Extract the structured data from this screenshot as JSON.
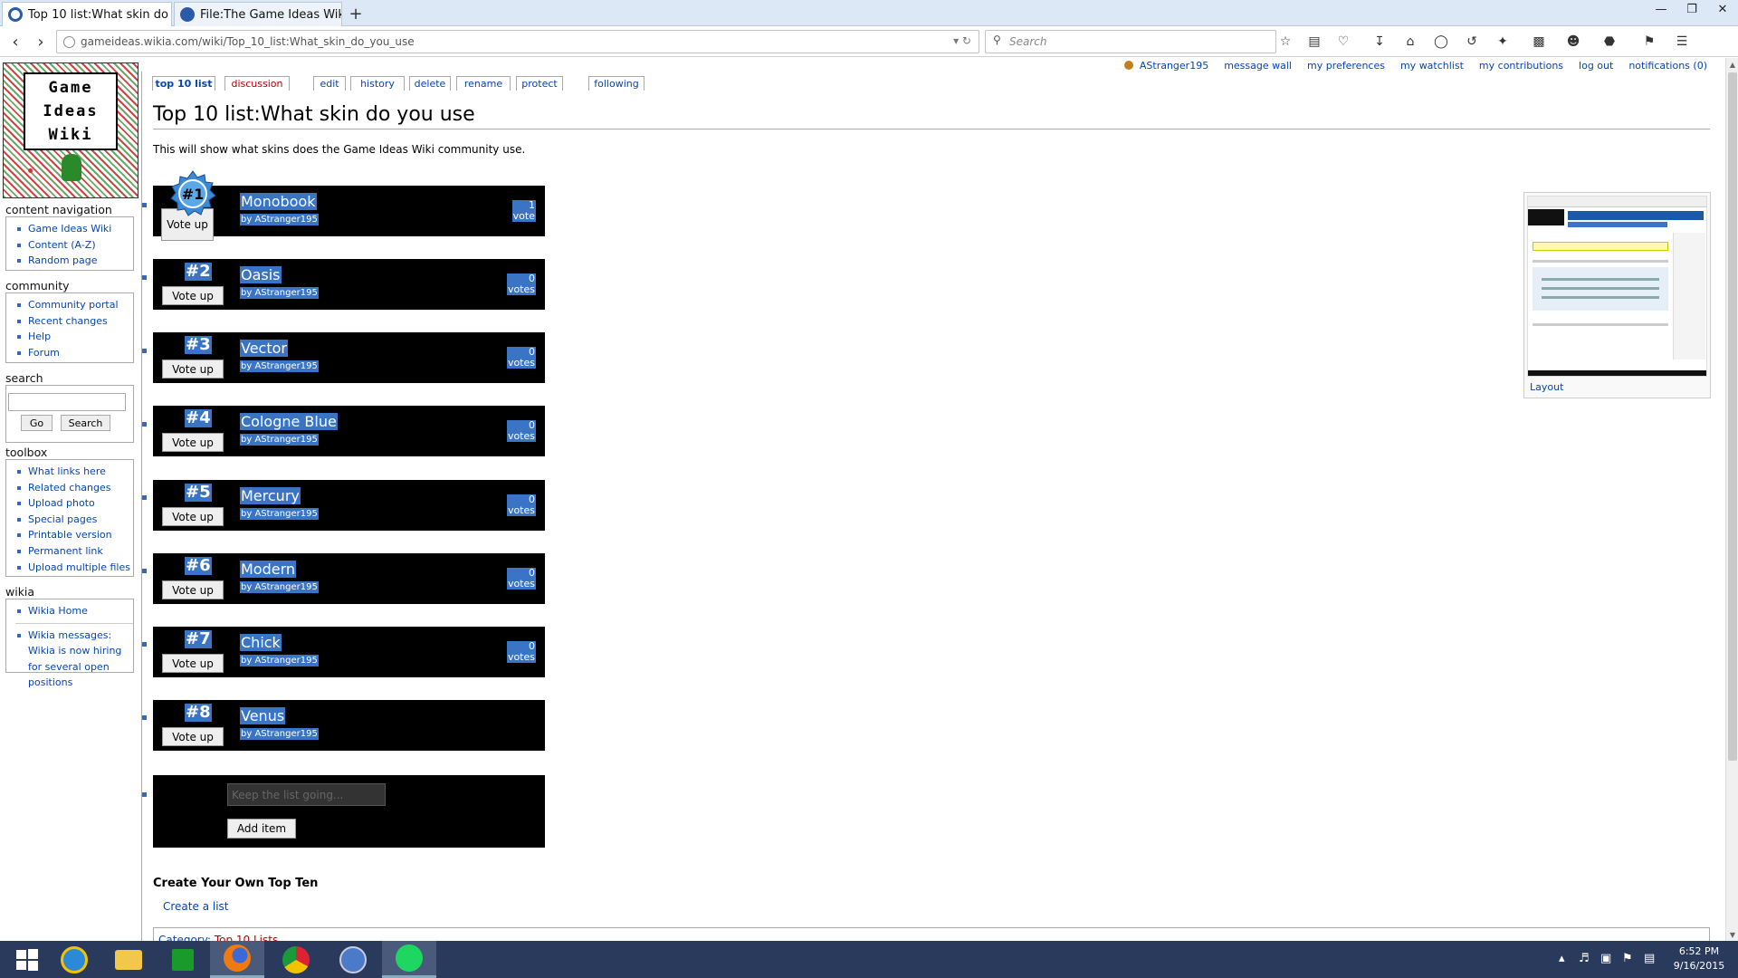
{
  "browser": {
    "tabs": [
      {
        "title": "Top 10 list:What skin do y...",
        "active": true
      },
      {
        "title": "File:The Game Ideas Wiki ...",
        "active": false
      }
    ],
    "url": "gameideas.wikia.com/wiki/Top_10_list:What_skin_do_you_use",
    "search_placeholder": "Search",
    "new_tab": "+",
    "close_glyph": "×"
  },
  "sidebar": {
    "sections": [
      {
        "heading": "content navigation",
        "items": [
          "Game Ideas Wiki",
          "Content (A-Z)",
          "Random page"
        ]
      },
      {
        "heading": "community",
        "items": [
          "Community portal",
          "Recent changes",
          "Help",
          "Forum"
        ]
      },
      {
        "heading": "toolbox",
        "items": [
          "What links here",
          "Related changes",
          "Upload photo",
          "Special pages",
          "Printable version",
          "Permanent link",
          "Upload multiple files"
        ]
      },
      {
        "heading": "wikia",
        "items": [
          "Wikia Home",
          "Wikia messages: Wikia is now hiring for several open positions"
        ]
      }
    ],
    "search": {
      "heading": "search",
      "go_label": "Go",
      "search_label": "Search"
    },
    "logo_words": [
      "Game",
      "Ideas",
      "Wiki"
    ]
  },
  "page_tabs": [
    {
      "label": "top 10 list",
      "selected": true
    },
    {
      "label": "discussion",
      "redlink": true
    },
    {
      "label": "edit"
    },
    {
      "label": "history"
    },
    {
      "label": "delete"
    },
    {
      "label": "rename"
    },
    {
      "label": "protect"
    },
    {
      "label": "following"
    }
  ],
  "userbar": [
    "AStranger195",
    "message wall",
    "my preferences",
    "my watchlist",
    "my contributions",
    "log out",
    "notifications (0)"
  ],
  "page": {
    "title": "Top 10 list:What skin do you use",
    "intro": "This will show what skins does the Game Ideas Wiki community use."
  },
  "list": {
    "items": [
      {
        "rank": "#1",
        "name": "Monobook",
        "by": "by AStranger195",
        "count": "1",
        "unit": "vote"
      },
      {
        "rank": "#2",
        "name": "Oasis",
        "by": "by AStranger195",
        "count": "0",
        "unit": "votes"
      },
      {
        "rank": "#3",
        "name": "Vector",
        "by": "by AStranger195",
        "count": "0",
        "unit": "votes"
      },
      {
        "rank": "#4",
        "name": "Cologne Blue",
        "by": "by AStranger195",
        "count": "0",
        "unit": "votes"
      },
      {
        "rank": "#5",
        "name": "Mercury",
        "by": "by AStranger195",
        "count": "0",
        "unit": "votes"
      },
      {
        "rank": "#6",
        "name": "Modern",
        "by": "by AStranger195",
        "count": "0",
        "unit": "votes"
      },
      {
        "rank": "#7",
        "name": "Chick",
        "by": "by AStranger195",
        "count": "0",
        "unit": "votes"
      },
      {
        "rank": "#8",
        "name": "Venus",
        "by": "by AStranger195",
        "count": "",
        "unit": ""
      }
    ],
    "vote_label": "Vote up",
    "add_placeholder": "Keep the list going...",
    "add_label": "Add item"
  },
  "create": {
    "heading": "Create Your Own Top Ten",
    "link": "Create a list"
  },
  "category": {
    "label": "Category:",
    "value": "Top 10 Lists"
  },
  "thumbnail": {
    "caption": "Layout"
  },
  "taskbar": {
    "time": "6:52 PM",
    "date": "9/16/2015"
  },
  "colors": {
    "link": "#0645ad",
    "redlink": "#ba0000",
    "highlight": "#3a74c4",
    "taskbar": "#2a3a5c"
  }
}
